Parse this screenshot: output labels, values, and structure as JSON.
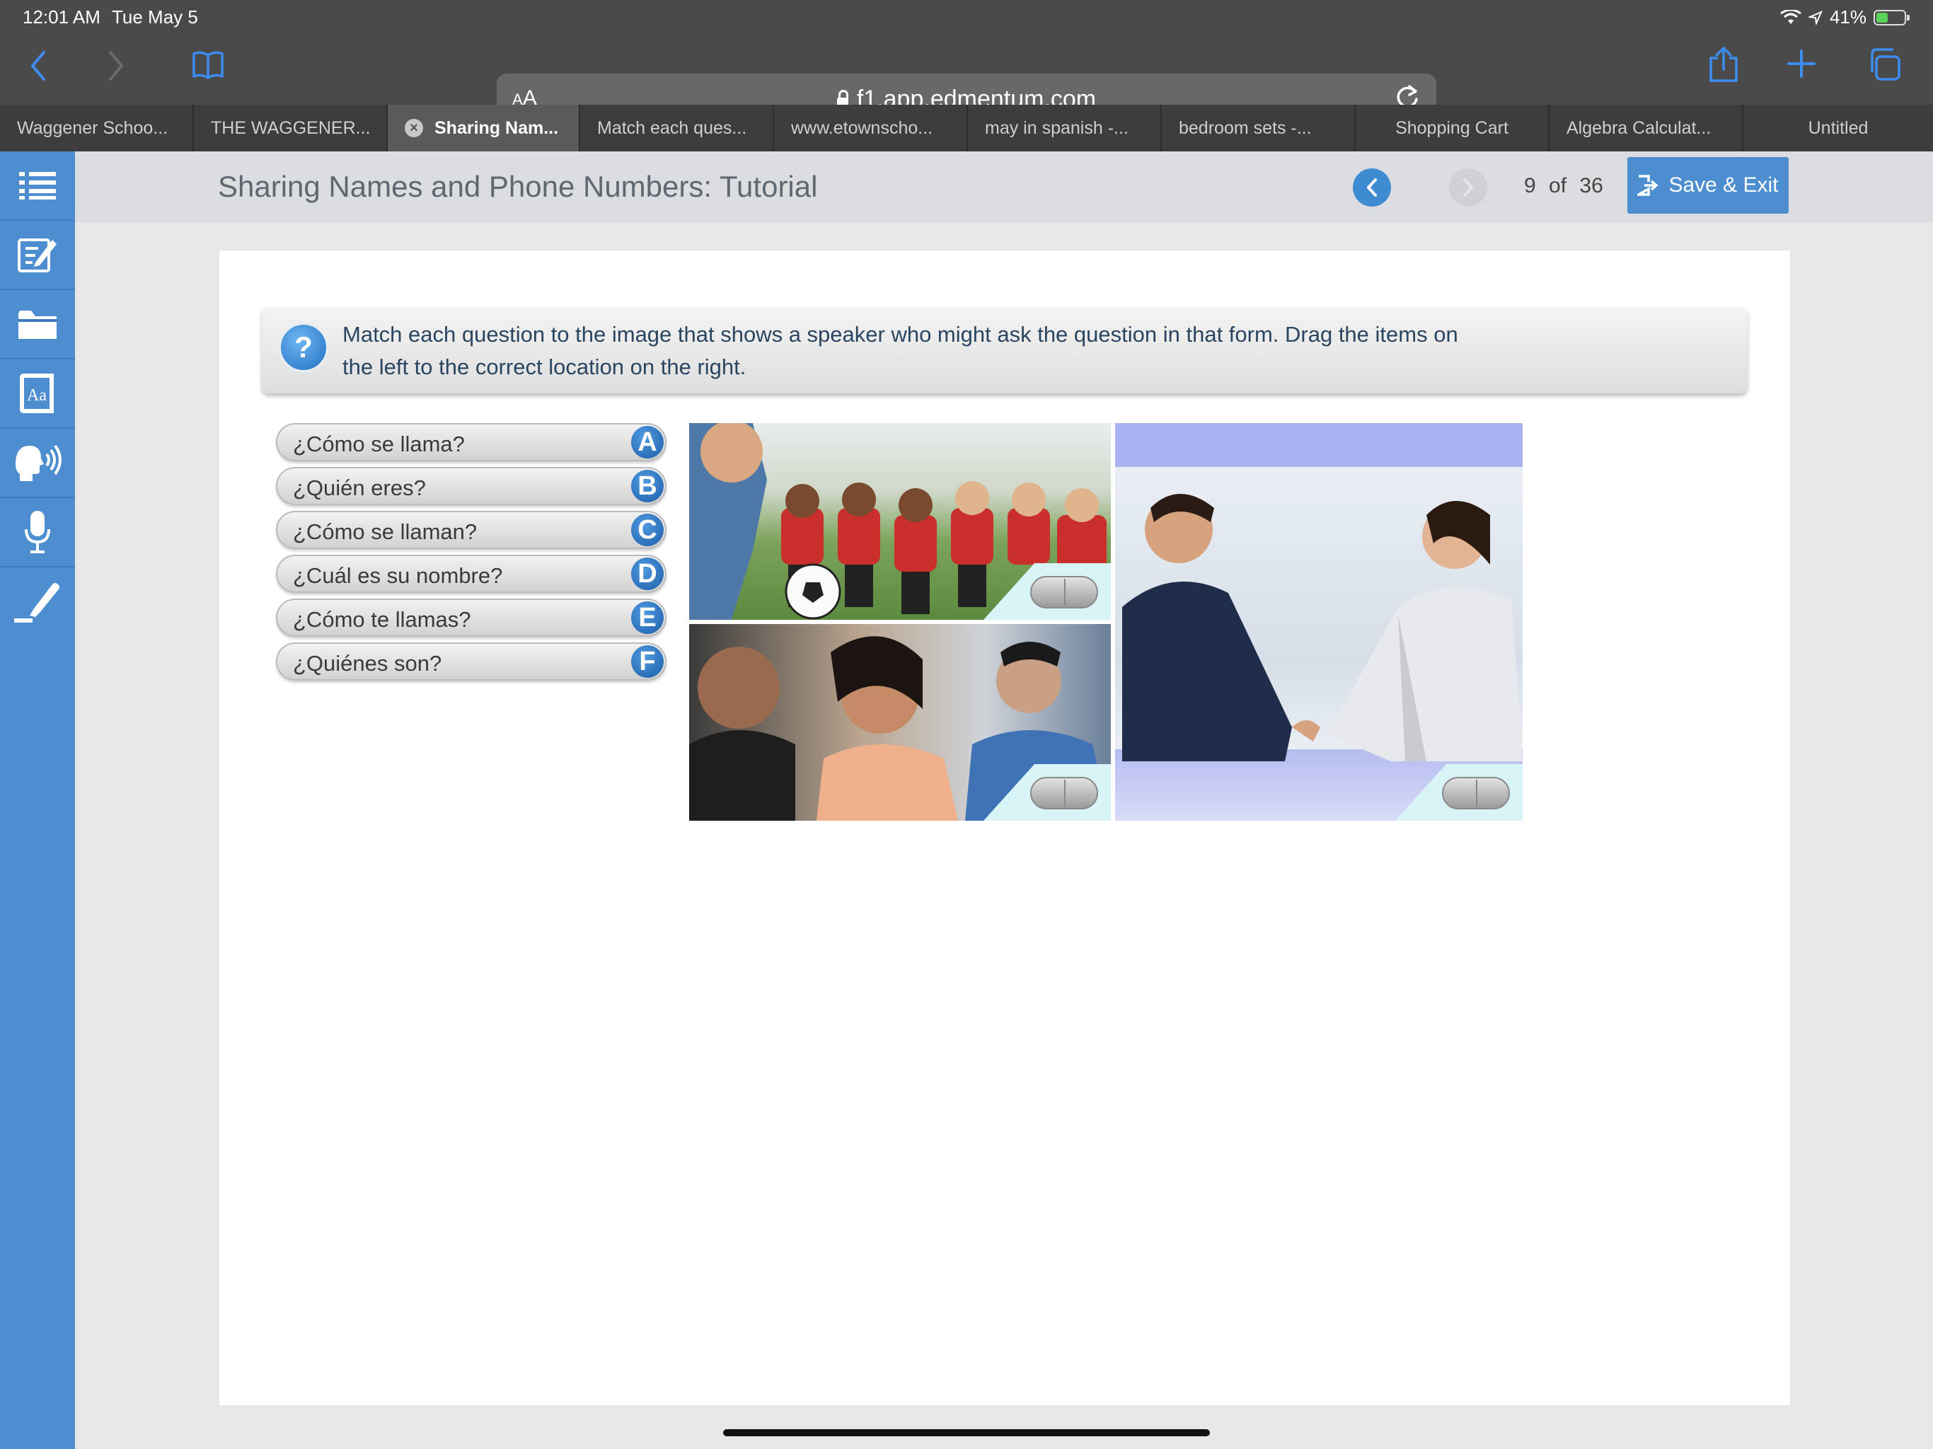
{
  "status_bar": {
    "time": "12:01 AM",
    "date": "Tue May 5",
    "battery": "41%",
    "battery_level": 0.41
  },
  "browser": {
    "reader_label": "AA",
    "url": "f1.app.edmentum.com",
    "tabs": [
      {
        "title": "Waggener Schoo..."
      },
      {
        "title": "THE WAGGENER..."
      },
      {
        "title": "Sharing Nam...",
        "active": true
      },
      {
        "title": "Match each ques..."
      },
      {
        "title": "www.etownscho..."
      },
      {
        "title": "may in spanish -..."
      },
      {
        "title": "bedroom sets -..."
      },
      {
        "title": "Shopping Cart"
      },
      {
        "title": "Algebra Calculat..."
      },
      {
        "title": "Untitled"
      }
    ]
  },
  "header": {
    "title": "Sharing Names and Phone Numbers: Tutorial",
    "page_current": "9",
    "page_of": "of",
    "page_total": "36",
    "save_exit_label": "Save & Exit"
  },
  "sidebar_icons": [
    "list-icon",
    "edit-icon",
    "folder-icon",
    "dictionary-icon",
    "speak-icon",
    "microphone-icon",
    "highlighter-icon"
  ],
  "activity": {
    "instruction_line1": "Match each question to the image that shows a speaker who might ask the question in that form. Drag the items on",
    "instruction_line2": "the left to the correct location on the right.",
    "items": [
      {
        "text": "¿Cómo se llama?",
        "letter": "A"
      },
      {
        "text": "¿Quién eres?",
        "letter": "B"
      },
      {
        "text": "¿Cómo se llaman?",
        "letter": "C"
      },
      {
        "text": "¿Cuál es su nombre?",
        "letter": "D"
      },
      {
        "text": "¿Cómo te llamas?",
        "letter": "E"
      },
      {
        "text": "¿Quiénes son?",
        "letter": "F"
      }
    ],
    "images": [
      {
        "id": "coach-with-kids-photo"
      },
      {
        "id": "teen-group-photo"
      },
      {
        "id": "business-handshake-photo"
      }
    ]
  },
  "colors": {
    "sidebar": "#4d8ed1",
    "accent": "#3f8bd2",
    "browser_chrome": "#4a4a4a",
    "link_blue": "#3d8cf0"
  }
}
